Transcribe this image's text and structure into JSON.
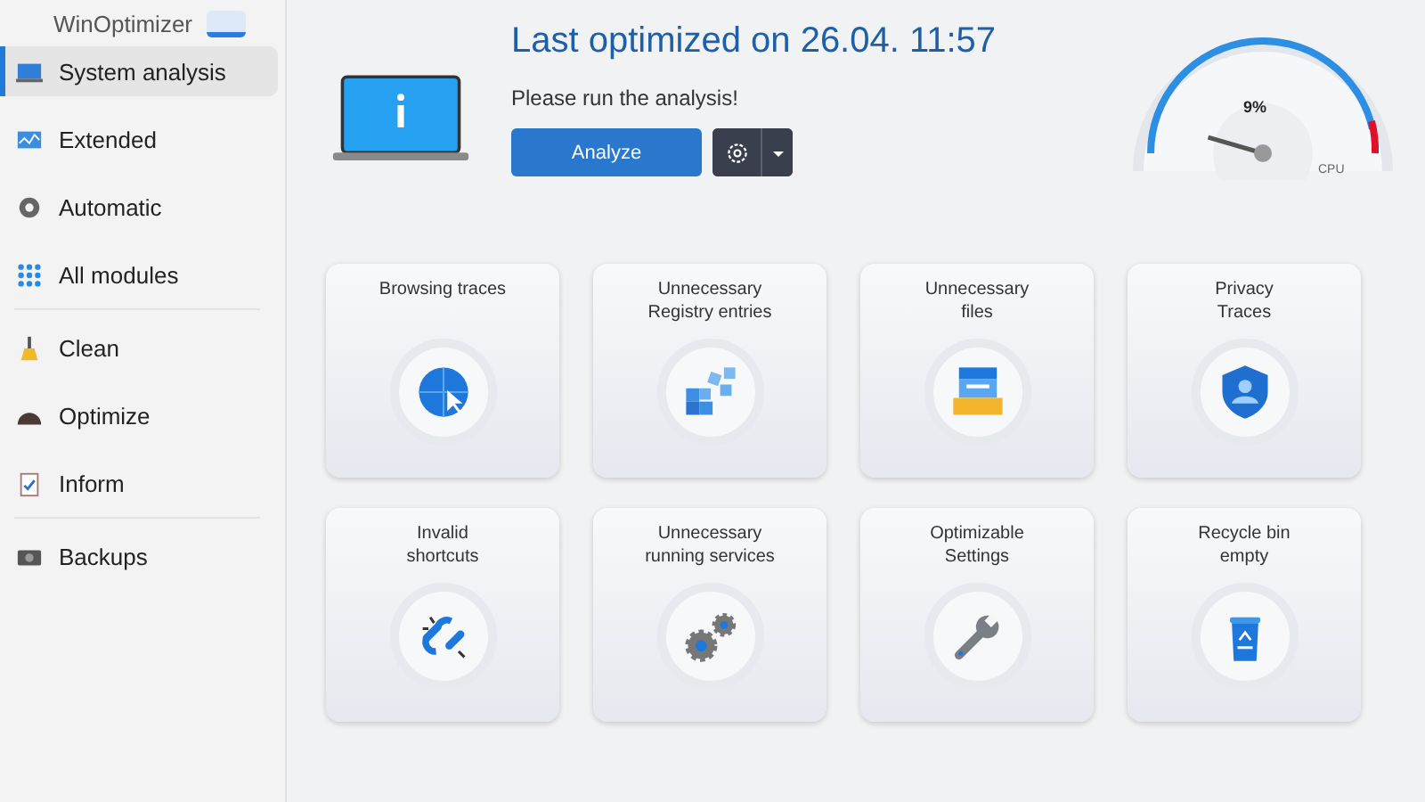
{
  "app": {
    "title": "WinOptimizer"
  },
  "sidebar": {
    "groups": [
      {
        "items": [
          {
            "label": "System analysis",
            "selected": true
          },
          {
            "label": "Extended",
            "selected": false
          },
          {
            "label": "Automatic",
            "selected": false
          },
          {
            "label": "All modules",
            "selected": false
          }
        ]
      },
      {
        "items": [
          {
            "label": "Clean",
            "selected": false
          },
          {
            "label": "Optimize",
            "selected": false
          },
          {
            "label": "Inform",
            "selected": false
          }
        ]
      },
      {
        "items": [
          {
            "label": "Backups",
            "selected": false
          }
        ]
      }
    ]
  },
  "header": {
    "title": "Last optimized on 26.04. 11:57",
    "message": "Please run the analysis!",
    "analyze_button": "Analyze"
  },
  "gauge": {
    "reading": "9%",
    "label": "CPU"
  },
  "tiles": [
    {
      "title": "Browsing traces"
    },
    {
      "title": "Unnecessary\nRegistry entries"
    },
    {
      "title": "Unnecessary\nfiles"
    },
    {
      "title": "Privacy\nTraces"
    },
    {
      "title": "Invalid\nshortcuts"
    },
    {
      "title": "Unnecessary\nrunning services"
    },
    {
      "title": "Optimizable\nSettings"
    },
    {
      "title": "Recycle bin\nempty"
    }
  ]
}
